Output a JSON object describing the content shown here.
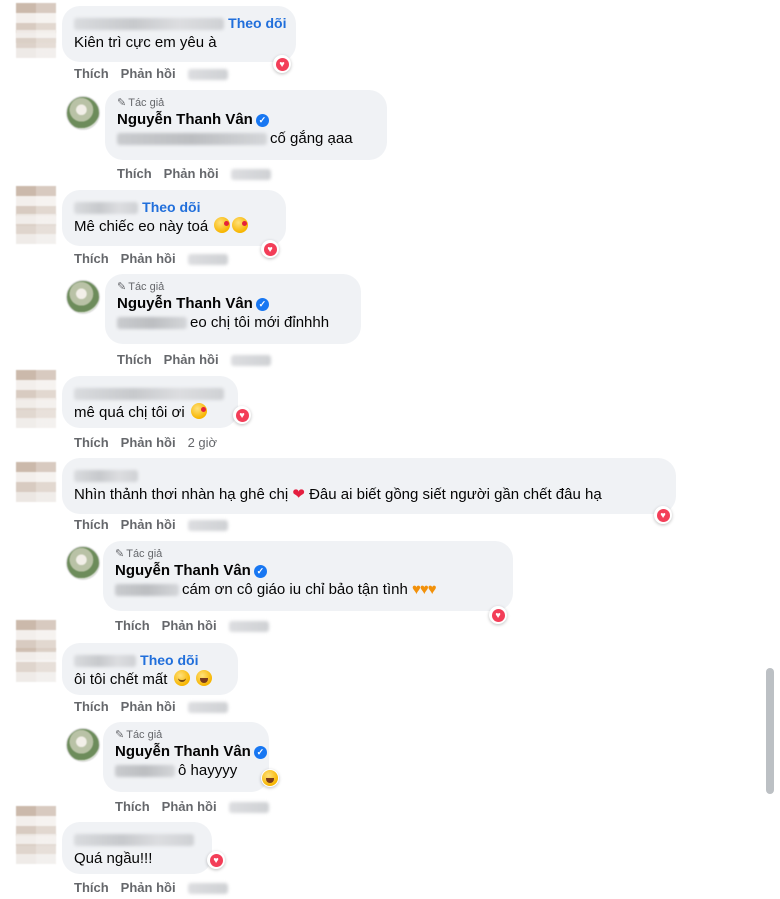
{
  "follow_label": "Theo dõi",
  "like_label": "Thích",
  "reply_label": "Phản hồi",
  "author_tag": "Tác giả",
  "author_name": "Nguyễn Thanh Vân",
  "comments": [
    {
      "text": "Kiên trì cực em yêu à"
    },
    {
      "text": "cố gắng ạaa"
    },
    {
      "text": "Mê chiếc eo này toá"
    },
    {
      "text": "eo chị tôi mới đỉnhhh"
    },
    {
      "text": "mê quá chị tôi ơi",
      "time": "2 giờ"
    },
    {
      "text_a": "Nhìn thảnh thơi nhàn hạ ghê chị",
      "text_b": "Đâu ai biết gồng siết người gần chết đâu hạ"
    },
    {
      "text": "cám ơn cô giáo iu chỉ bảo tận tình"
    },
    {
      "text": "ôi tôi chết mất"
    },
    {
      "text": "ô hayyyy"
    },
    {
      "text": "Quá ngầu!!!"
    }
  ],
  "icons": {
    "reaction": "heart-reaction-icon",
    "verified": "verified-badge-icon",
    "pen": "pencil-icon"
  },
  "colors": {
    "follow": "#216fdb",
    "bubble": "#f0f2f5",
    "heart": "#f33e58"
  }
}
